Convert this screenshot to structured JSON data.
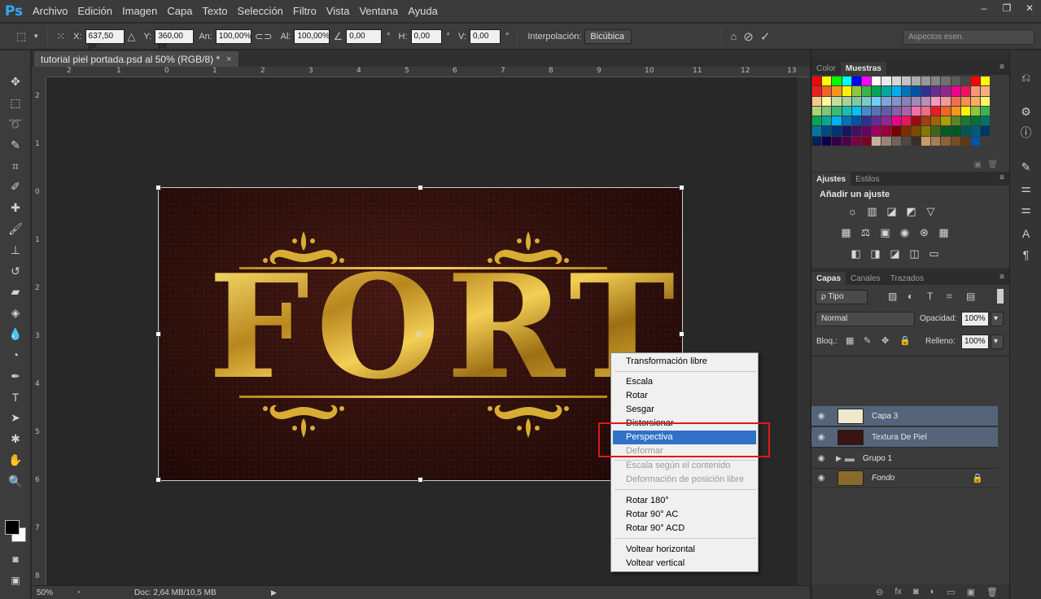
{
  "app": {
    "logo": "Ps"
  },
  "menu": [
    "Archivo",
    "Edición",
    "Imagen",
    "Capa",
    "Texto",
    "Selección",
    "Filtro",
    "Vista",
    "Ventana",
    "Ayuda"
  ],
  "window_controls": {
    "minimize": "–",
    "restore": "❐",
    "close": "✕"
  },
  "options": {
    "x_label": "X:",
    "x_value": "637,50 px",
    "y_label": "Y:",
    "y_value": "360,00 px",
    "w_label": "An:",
    "w_value": "100,00%",
    "h_label": "Al:",
    "h_value": "100,00%",
    "angle_value": "0,00",
    "deg": "°",
    "hskew_label": "H:",
    "hskew_value": "0,00",
    "vskew_label": "V:",
    "vskew_value": "0,00",
    "interp_label": "Interpolación:",
    "interp_value": "Bicúbica",
    "workspace": "Aspectos esen."
  },
  "document": {
    "tab_title": "tutorial piel portada.psd al 50% (RGB/8) *",
    "close": "×"
  },
  "ruler": {
    "top": [
      "2",
      "1",
      "0",
      "1",
      "2",
      "3",
      "4",
      "5",
      "6",
      "7",
      "8",
      "9",
      "10",
      "11",
      "12",
      "13"
    ],
    "left": [
      "2",
      "1",
      "0",
      "1",
      "2",
      "3",
      "4",
      "5",
      "6",
      "7",
      "8"
    ]
  },
  "canvas": {
    "art_text": "FORT"
  },
  "status": {
    "zoom": "50%",
    "doc": "Doc: 2,64 MB/10,5 MB",
    "arrow": "▶"
  },
  "context_menu": {
    "items": [
      {
        "label": "Transformación libre",
        "state": "normal"
      },
      {
        "label": "Escala",
        "state": "normal"
      },
      {
        "label": "Rotar",
        "state": "normal"
      },
      {
        "label": "Sesgar",
        "state": "normal"
      },
      {
        "label": "Distorsionar",
        "state": "normal"
      },
      {
        "label": "Perspectiva",
        "state": "highlighted"
      },
      {
        "label": "Deformar",
        "state": "disabled"
      },
      {
        "label": "Escala según el contenido",
        "state": "disabled"
      },
      {
        "label": "Deformación de posición libre",
        "state": "disabled"
      },
      {
        "label": "Rotar 180°",
        "state": "normal"
      },
      {
        "label": "Rotar 90° AC",
        "state": "normal"
      },
      {
        "label": "Rotar 90° ACD",
        "state": "normal"
      },
      {
        "label": "Voltear horizontal",
        "state": "normal"
      },
      {
        "label": "Voltear vertical",
        "state": "normal"
      }
    ]
  },
  "color_panel": {
    "tabs": [
      "Color",
      "Muestras"
    ],
    "active": "Muestras"
  },
  "swatches": [
    "#ff0000",
    "#ffff00",
    "#00ff00",
    "#00ffff",
    "#0000ff",
    "#ff00ff",
    "#ffffff",
    "#ebebeb",
    "#d6d6d6",
    "#c2c2c2",
    "#adadad",
    "#999999",
    "#858585",
    "#707070",
    "#5c5c5c",
    "#474747",
    "#ff0000",
    "#ffff00",
    "#ed1c24",
    "#f26522",
    "#f7941d",
    "#fff200",
    "#8dc63f",
    "#39b54a",
    "#00a651",
    "#00a99d",
    "#00aeef",
    "#0072bc",
    "#0054a6",
    "#2e3192",
    "#662d91",
    "#92278f",
    "#ec008c",
    "#ed145b",
    "#f69679",
    "#f9ad81",
    "#fdc68a",
    "#fff799",
    "#c4df9b",
    "#a3d39c",
    "#82ca9c",
    "#7accc8",
    "#6dcff6",
    "#7da7d9",
    "#8393ca",
    "#8781bd",
    "#a187be",
    "#bd8cbf",
    "#f49ac1",
    "#f5989d",
    "#f26c4f",
    "#f68e56",
    "#fbaf5d",
    "#fff568",
    "#acd372",
    "#7cc576",
    "#3bb878",
    "#1abbb4",
    "#00bff3",
    "#438ccb",
    "#5574b9",
    "#605ca8",
    "#855fa8",
    "#a763a8",
    "#f06eaa",
    "#f26d7d",
    "#ed1c24",
    "#f26522",
    "#f7941d",
    "#fff200",
    "#8dc63f",
    "#39b54a",
    "#00a651",
    "#00a99d",
    "#00aeef",
    "#0072bc",
    "#0054a6",
    "#2e3192",
    "#662d91",
    "#92278f",
    "#ec008c",
    "#ed145b",
    "#9e0b0f",
    "#a0410d",
    "#a36209",
    "#aba000",
    "#598527",
    "#1a7b30",
    "#007236",
    "#00746b",
    "#0076a3",
    "#004b80",
    "#003471",
    "#1b1464",
    "#440e62",
    "#630460",
    "#9e005d",
    "#9e0039",
    "#790000",
    "#7b2e00",
    "#7d4900",
    "#827b00",
    "#406618",
    "#005e20",
    "#005826",
    "#005952",
    "#005b7f",
    "#003663",
    "#002157",
    "#0d004c",
    "#32004b",
    "#4b0049",
    "#7b0046",
    "#7a0026",
    "#c7b299",
    "#998675",
    "#736357",
    "#534741",
    "#37302d",
    "#c69c6d",
    "#a67c52",
    "#8c6239",
    "#754c24",
    "#603913",
    "#0054a6",
    "#3c3c3c"
  ],
  "adjust_panel": {
    "tabs": [
      "Ajustes",
      "Estilos"
    ],
    "active": "Ajustes",
    "title": "Añadir un ajuste",
    "row1": [
      "☼",
      "▥",
      "◪",
      "◩",
      "▽"
    ],
    "row2": [
      "▦",
      "⚖",
      "▣",
      "◉",
      "⊛",
      "▦"
    ],
    "row3": [
      "◧",
      "◨",
      "◪",
      "◫",
      "▭"
    ]
  },
  "layers_panel": {
    "tabs": [
      "Capas",
      "Canales",
      "Trazados"
    ],
    "active": "Capas",
    "filter": "ρ Tipo",
    "blend": "Normal",
    "opacity_label": "Opacidad:",
    "opacity": "100%",
    "lock_label": "Bloq.:",
    "fill_label": "Relleno:",
    "fill": "100%",
    "layers": [
      {
        "name": "Capa 3",
        "selected": true,
        "italic": false,
        "thumb": "#e8e2c8"
      },
      {
        "name": "Textura De Piel",
        "selected": true,
        "italic": false,
        "thumb": "#3a1410"
      },
      {
        "name": "Grupo 1",
        "selected": false,
        "italic": false,
        "thumb": "folder"
      },
      {
        "name": "Fondo",
        "selected": false,
        "italic": true,
        "thumb": "#8a6a2a"
      }
    ],
    "bottom_icons": [
      "⊖",
      "fx",
      "◙",
      "◐",
      "▭",
      "▣",
      "🗑"
    ]
  }
}
